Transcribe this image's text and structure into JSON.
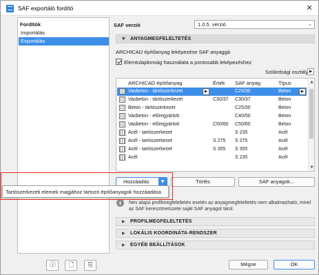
{
  "window": {
    "title": "SAF exportáló fordító",
    "close_glyph": "✕"
  },
  "sidebar": {
    "heading": "Fordítók",
    "items": [
      {
        "label": "Importálás",
        "selected": false
      },
      {
        "label": "Exportálás",
        "selected": true
      }
    ]
  },
  "saf_version": {
    "label": "SAF verzió",
    "value": "1.0.5. verzió"
  },
  "sections": {
    "material_mapping": "ANYAGMEGFELELTETÉS",
    "profile_mapping": "PROFILMEGFELELTETÉS",
    "local_coords": "LOKÁLIS KOORDINÁTA-RENDSZER",
    "other_settings": "EGYÉB BEÁLLÍTÁSOK"
  },
  "material": {
    "description": "ARCHICAD építőanyag leképezése SAF anyaggá",
    "checkbox_label": "Elemtulajdonság használata a pontosabb leképezéshez",
    "checkbox_checked": true,
    "strength_label": "Szilárdsági osztály",
    "columns": [
      "ARCHICAD építőanyag",
      "Érték",
      "SAF anyag",
      "Típus"
    ],
    "rows": [
      {
        "material": "Vasbeton - tártószerkezet",
        "value": "",
        "saf": "C25/30",
        "type": "Beton",
        "swatch": "concrete"
      },
      {
        "material": "Vasbeton - tártószerkezet",
        "value": "C30/37",
        "saf": "C30/37",
        "type": "Beton",
        "swatch": "concrete"
      },
      {
        "material": "Beton - tártószerkezet",
        "value": "",
        "saf": "C25/30",
        "type": "Beton",
        "swatch": "concrete"
      },
      {
        "material": "Vasbeton - előregyártott",
        "value": "",
        "saf": "C40/50",
        "type": "Beton",
        "swatch": "concrete"
      },
      {
        "material": "Vasbeton - előregyártott",
        "value": "C50/60",
        "saf": "C50/60",
        "type": "Beton",
        "swatch": "concrete"
      },
      {
        "material": "Acél - tartószerkezet",
        "value": "",
        "saf": "S 235",
        "type": "Acél",
        "swatch": "steel"
      },
      {
        "material": "Acél - tartószerkezet",
        "value": "S 275",
        "saf": "S 275",
        "type": "Acél",
        "swatch": "steel"
      },
      {
        "material": "Acél - tartószerkezet",
        "value": "S 355",
        "saf": "S 355",
        "type": "Acél",
        "swatch": "steel"
      },
      {
        "material": "Acél",
        "value": "",
        "saf": "S 235",
        "type": "Acél",
        "swatch": "steel"
      }
    ],
    "add_button": "Hozzáadás",
    "delete_button": "Törlés",
    "saf_materials_button": "SAF anyagok..."
  },
  "popup": {
    "item": "Tartószerkezeti elemek magjához tartozó építőanyagok hozzáadása"
  },
  "info": {
    "text": "Nev alapú profilmegfeleltetés esetén az anyagmegfeleltetés nem alkalmazható, mivel az SAF keresztmetszete saját SAF anyagot tárol."
  },
  "footer": {
    "cancel": "Mégse",
    "ok": "OK"
  },
  "colors": {
    "accent": "#3d8ee8",
    "highlight": "#e8261c"
  }
}
